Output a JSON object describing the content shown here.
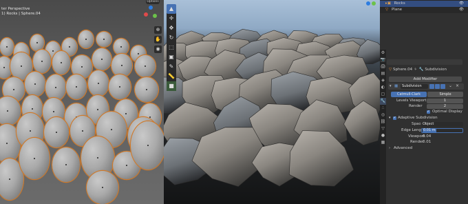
{
  "left_viewport": {
    "header_line1": "ter Perspective",
    "header_line2": "1) Rocks | Sphere.04",
    "options_button": "Options",
    "gizmo_labels": {
      "x": "X",
      "y": "Y",
      "z": "Z"
    }
  },
  "middle_viewport": {
    "tools": [
      "cursor",
      "move",
      "rotate",
      "scale",
      "transform",
      "annotate",
      "measure",
      "add-cube"
    ],
    "view_icons": [
      "zoom",
      "pan",
      "camera",
      "grid"
    ]
  },
  "outliner": {
    "rows": [
      {
        "label": "Rocks"
      },
      {
        "label": "Plane"
      }
    ]
  },
  "properties": {
    "breadcrumb_object": "Sphere.04",
    "breadcrumb_modifier": "Subdivision",
    "add_modifier": "Add Modifier",
    "modifier_name": "Subdivision",
    "tab_catmull": "Catmull-Clark",
    "tab_simple": "Simple",
    "levels_viewport_label": "Levels Viewport",
    "levels_viewport_value": "1",
    "render_label": "Render",
    "render_value": "2",
    "optimal_display": "Optimal Display",
    "adaptive_subdivision": "Adaptive Subdivision",
    "space_label": "Space",
    "space_value": "Object",
    "edge_length_label": "Edge Length",
    "edge_length_value": "0.01 m",
    "viewport_label": "Viewport",
    "viewport_value": "0.04",
    "render2_label": "Render",
    "render2_value": "0.01",
    "advanced": "Advanced"
  }
}
